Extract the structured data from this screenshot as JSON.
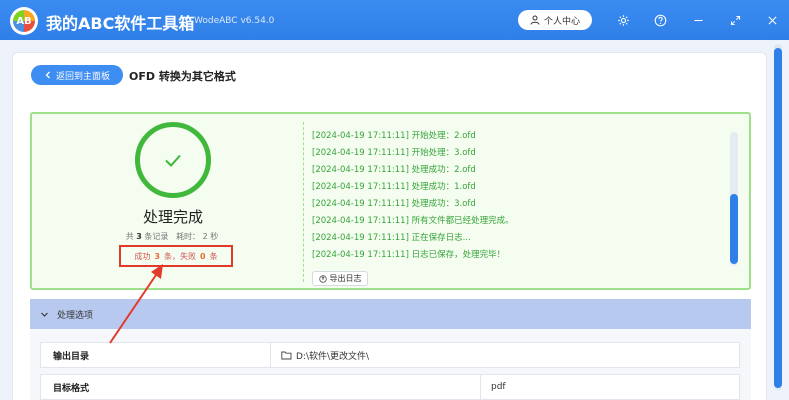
{
  "app": {
    "title": "我的ABC软件工具箱",
    "version": "WodeABC v6.54.0",
    "logo_text": "AB"
  },
  "header": {
    "user_label": "个人中心"
  },
  "page": {
    "back_label": "返回到主面板",
    "title": "OFD 转换为其它格式"
  },
  "result": {
    "status": "处理完成",
    "stats": {
      "prefix": "共",
      "total": "3",
      "records_label": "条记录",
      "elapsed_label": "耗时：",
      "elapsed_value": "2 秒"
    },
    "summary": {
      "success_label": "成功",
      "success_count": "3",
      "success_unit": "条，失败",
      "fail_count": "0",
      "fail_unit": "条"
    },
    "log": [
      "[2024-04-19 17:11:11] 开始处理：2.ofd",
      "[2024-04-19 17:11:11] 开始处理：3.ofd",
      "[2024-04-19 17:11:11] 处理成功：2.ofd",
      "[2024-04-19 17:11:11] 处理成功：1.ofd",
      "[2024-04-19 17:11:11] 处理成功：3.ofd",
      "[2024-04-19 17:11:11] 所有文件都已经处理完成。",
      "[2024-04-19 17:11:11] 正在保存日志...",
      "[2024-04-19 17:11:11] 日志已保存，处理完毕！"
    ],
    "export_label": "导出日志"
  },
  "options": {
    "header": "处理选项",
    "rows": [
      {
        "label": "输出目录",
        "value": "D:\\软件\\更改文件\\"
      },
      {
        "label": "目标格式",
        "value": "pdf"
      }
    ]
  },
  "colors": {
    "brand": "#2f7fe8",
    "success": "#3fb83c",
    "highlight": "#e23a2a"
  }
}
